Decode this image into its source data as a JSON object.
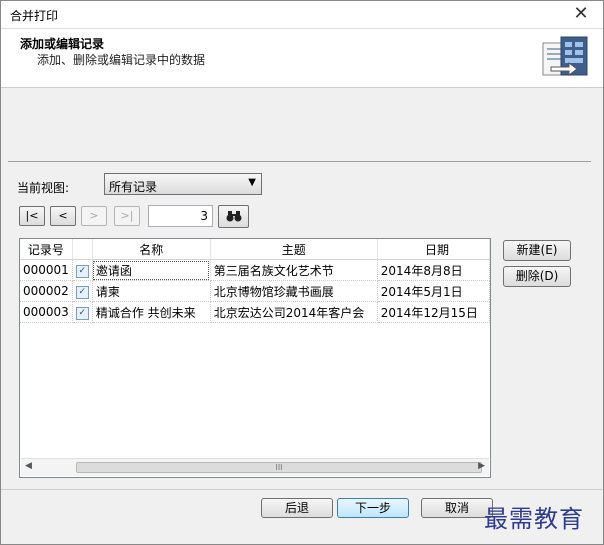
{
  "window": {
    "title": "合并打印",
    "close_glyph": "✕"
  },
  "header": {
    "title": "添加或编辑记录",
    "subtitle": "添加、删除或编辑记录中的数据",
    "icon": "merge-document-icon"
  },
  "view": {
    "label": "当前视图:",
    "selected": "所有记录"
  },
  "navigator": {
    "first": "|<",
    "prev": "<",
    "next": ">",
    "last": ">|",
    "record_number": "3"
  },
  "table": {
    "columns": [
      "记录号",
      "",
      "名称",
      "主题",
      "日期"
    ],
    "rows": [
      {
        "id": "000001",
        "checked": true,
        "name": "邀请函",
        "subject": "第三届名族文化艺术节",
        "date": "2014年8月8日"
      },
      {
        "id": "000002",
        "checked": true,
        "name": "请柬",
        "subject": "北京博物馆珍藏书画展",
        "date": "2014年5月1日"
      },
      {
        "id": "000003",
        "checked": true,
        "name": "精诚合作 共创未来",
        "subject": "北京宏达公司2014年客户会",
        "date": "2014年12月15日"
      }
    ]
  },
  "side_buttons": {
    "new": "新建(E)",
    "delete": "删除(D)"
  },
  "footer": {
    "back": "后退",
    "next": "下一步",
    "cancel": "取消"
  },
  "watermark": "最需教育",
  "colors": {
    "accent": "#3c7fb1",
    "watermark": "#2e3b8f"
  }
}
